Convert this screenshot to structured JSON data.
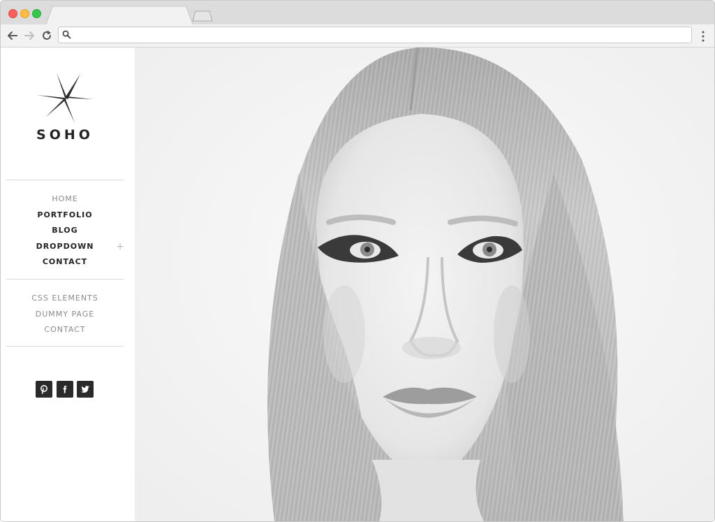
{
  "browser": {
    "search_placeholder": ""
  },
  "logo": {
    "text": "SOHO"
  },
  "nav_primary": [
    {
      "label": "HOME",
      "muted": true
    },
    {
      "label": "PORTFOLIO"
    },
    {
      "label": "BLOG"
    },
    {
      "label": "DROPDOWN",
      "expander": "+"
    },
    {
      "label": "CONTACT"
    }
  ],
  "nav_secondary": [
    {
      "label": "CSS ELEMENTS"
    },
    {
      "label": "DUMMY PAGE"
    },
    {
      "label": "CONTACT"
    }
  ],
  "social": [
    "pinterest-icon",
    "facebook-icon",
    "twitter-icon"
  ],
  "colors": {
    "accent": "#222222",
    "muted": "#8a8a8a",
    "social_bg": "#2a2a2a"
  }
}
